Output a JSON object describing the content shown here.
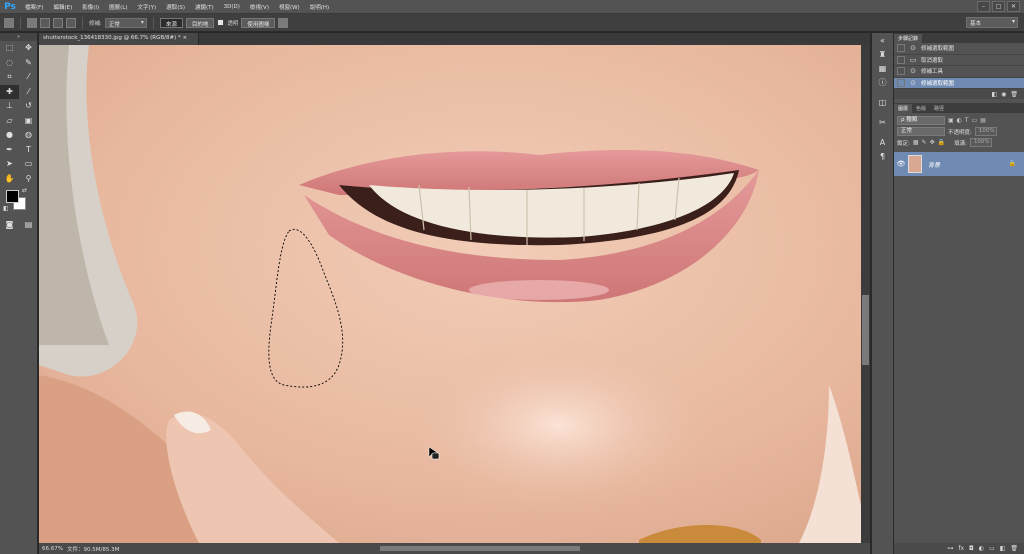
{
  "app": {
    "logo": "Ps"
  },
  "menu": [
    "檔案(F)",
    "編輯(E)",
    "影像(I)",
    "圖層(L)",
    "文字(Y)",
    "選取(S)",
    "濾鏡(T)",
    "3D(D)",
    "檢視(V)",
    "視窗(W)",
    "說明(H)"
  ],
  "window_controls": [
    "–",
    "□",
    "✕"
  ],
  "options": {
    "repair_label": "修補:",
    "mode_value": "正常",
    "source_button": "來源",
    "destination_button": "目的地",
    "transparent_label": "透明",
    "use_pattern_button": "使用圖樣",
    "workspace": "基本"
  },
  "document": {
    "tab_title": "shutterstock_136418330.jpg @ 66.7% (RGB/8#) *",
    "tab_close": "×",
    "zoom": "66.67%",
    "doc_info": "文件：90.5M/85.3M"
  },
  "history": {
    "tabs": [
      "步驟記錄"
    ],
    "items": [
      {
        "label": "修補選取範圍",
        "icon": "patch-icon"
      },
      {
        "label": "取消選取",
        "icon": "deselect-icon"
      },
      {
        "label": "修補工具",
        "icon": "patch-icon"
      },
      {
        "label": "修補選取範圍",
        "icon": "patch-icon"
      }
    ],
    "selected_index": 3
  },
  "layers": {
    "tabs": [
      "圖層",
      "色版",
      "路徑"
    ],
    "filter_value": "ρ 種類",
    "blend_mode": "正常",
    "opacity_label": "不透明度:",
    "opacity_value": "100%",
    "lock_label": "鎖定:",
    "fill_label": "填滿:",
    "fill_value": "100%",
    "layer_name": "背景"
  }
}
